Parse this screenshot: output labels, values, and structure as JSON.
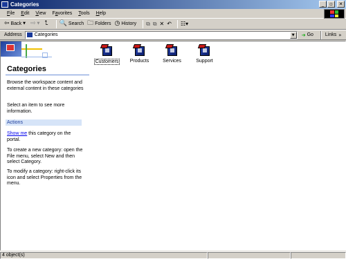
{
  "window": {
    "title": "Categories"
  },
  "menu": [
    "File",
    "Edit",
    "View",
    "Favorites",
    "Tools",
    "Help"
  ],
  "menu_mnemonics": [
    "F",
    "E",
    "V",
    "a",
    "T",
    "H"
  ],
  "toolbar": {
    "back_label": "Back",
    "search_label": "Search",
    "folders_label": "Folders",
    "history_label": "History"
  },
  "address": {
    "label": "Address",
    "value": "Categories",
    "go_label": "Go",
    "links_label": "Links"
  },
  "left_pane": {
    "title": "Categories",
    "description": "Browse the workspace content and external content in these categories",
    "select_hint": "Select an item to see more information.",
    "actions_header": "Actions",
    "show_me_link": "Show me",
    "show_me_rest": " this category on the portal.",
    "create_text": "To create a new category: open the File menu, select New and then select Category.",
    "modify_text": "To modify a category: right-click its icon and select Properties from the menu."
  },
  "categories": [
    {
      "label": "Customers",
      "icon": "category-folder-icon",
      "selected": true
    },
    {
      "label": "Products",
      "icon": "category-folder-icon",
      "selected": false
    },
    {
      "label": "Services",
      "icon": "category-folder-icon",
      "selected": false
    },
    {
      "label": "Support",
      "icon": "category-folder-icon",
      "selected": false
    }
  ],
  "status": {
    "objects": "4 object(s)"
  },
  "colors": {
    "title_bar": "#0a246a",
    "link": "#0000ee",
    "icon_blue": "#233fa8",
    "icon_red": "#c81818"
  }
}
